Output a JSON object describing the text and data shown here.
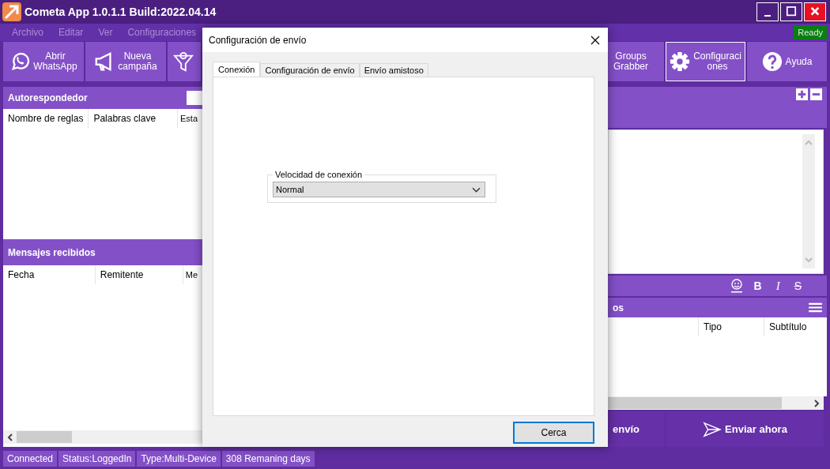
{
  "window": {
    "title": "Cometa App 1.0.1.1 Build:2022.04.14"
  },
  "menu": [
    "Archivo",
    "Editar",
    "Ver",
    "Configuraciones"
  ],
  "ready_badge": "Ready",
  "toolbar_left": [
    {
      "lines": [
        "Abrir",
        "WhatsApp"
      ],
      "selected": false
    },
    {
      "lines": [
        "Nueva",
        "campaña"
      ],
      "selected": false
    },
    {
      "selected": false
    }
  ],
  "toolbar_right": [
    {
      "lines": [
        "Groups",
        "Grabber"
      ],
      "selected": false
    },
    {
      "lines": [
        "Configuraci",
        "ones"
      ],
      "selected": true
    },
    {
      "lines": [
        "Ayuda"
      ],
      "selected": false
    }
  ],
  "autoresponder": {
    "title": "Autorespondedor",
    "columns": [
      "Nombre de reglas",
      "Palabras clave",
      "Esta"
    ]
  },
  "received": {
    "title": "Mensajes recibidos",
    "columns": [
      "Fecha",
      "Remitente",
      "Me"
    ]
  },
  "format_buttons": [
    {
      "kind": "emoji"
    },
    {
      "kind": "bold",
      "label": "B"
    },
    {
      "kind": "italic",
      "label": "I"
    },
    {
      "kind": "strike",
      "label": "S"
    }
  ],
  "list_panel": {
    "title": "os",
    "columns": [
      "Tipo",
      "Subtítulo"
    ]
  },
  "actions": [
    "envío",
    "Enviar ahora"
  ],
  "status_bar": [
    "Connected",
    "Status:LoggedIn",
    "Type:Multi-Device",
    "308 Remaning days"
  ],
  "dialog": {
    "title": "Configuración de envío",
    "tabs": [
      {
        "label": "Conexión",
        "selected": true
      },
      {
        "label": "Configuración de envío",
        "selected": false
      },
      {
        "label": "Envío amistoso",
        "selected": false
      }
    ],
    "group": {
      "title": "Velocidad de conexión",
      "value": "Normal"
    },
    "buttons": [
      {
        "label": "Cerca",
        "default": true
      }
    ]
  }
}
